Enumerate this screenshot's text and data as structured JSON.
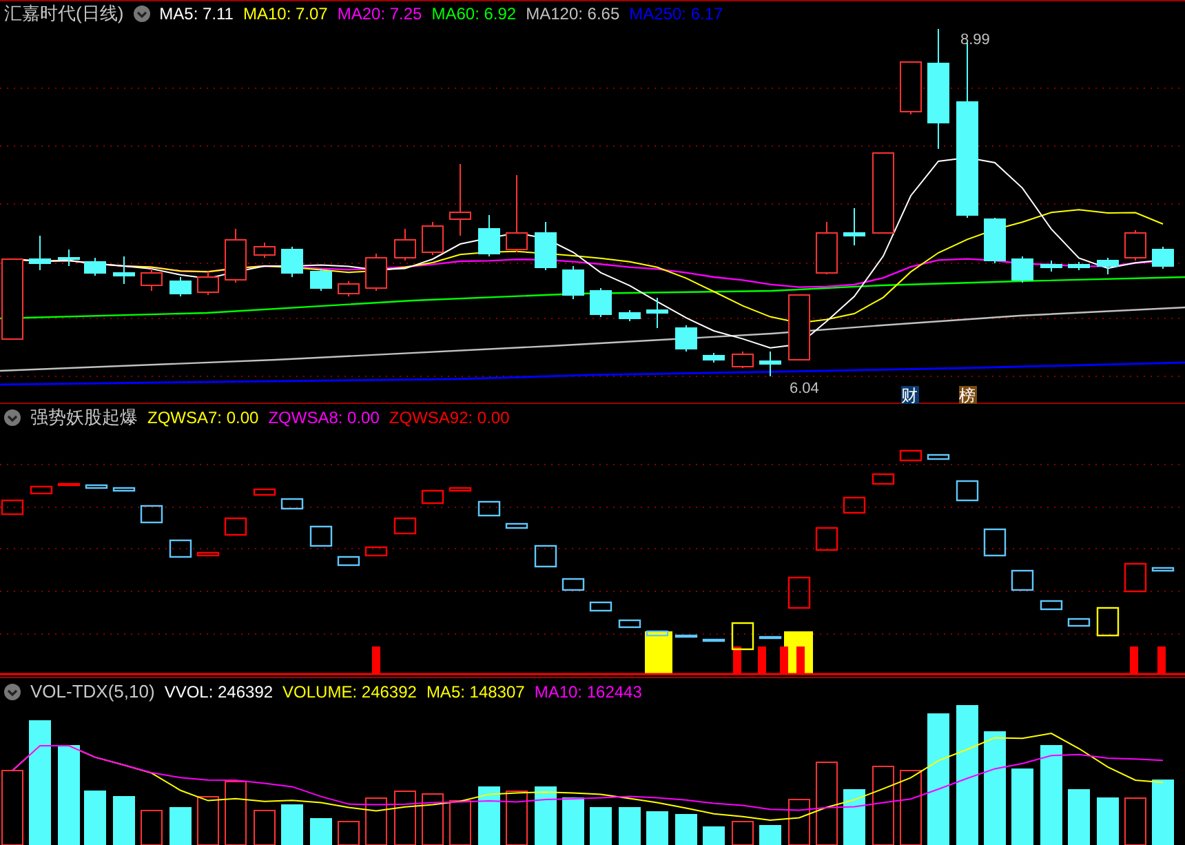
{
  "main": {
    "title": "汇嘉时代(日线)",
    "indicators": [
      {
        "label": "MA5: 7.11",
        "color": "#ffffff"
      },
      {
        "label": "MA10: 7.07",
        "color": "#ffff00"
      },
      {
        "label": "MA20: 7.25",
        "color": "#ff00ff"
      },
      {
        "label": "MA60: 6.92",
        "color": "#00ff00"
      },
      {
        "label": "MA120: 6.65",
        "color": "#c0c0c0"
      },
      {
        "label": "MA250: 6.17",
        "color": "#0000ff"
      }
    ],
    "high_label": "8.99",
    "low_label": "6.04",
    "badges": [
      {
        "text": "财",
        "color": "#0a3a6e"
      },
      {
        "text": "榜",
        "color": "#7a4a10"
      }
    ]
  },
  "signal": {
    "title": "强势妖股起爆",
    "indicators": [
      {
        "label": "ZQWSA7: 0.00",
        "color": "#ffff00"
      },
      {
        "label": "ZQWSA8: 0.00",
        "color": "#ff00ff"
      },
      {
        "label": "ZQWSA92: 0.00",
        "color": "#ff0000"
      }
    ]
  },
  "volume": {
    "title": "VOL-TDX(5,10)",
    "indicators": [
      {
        "label": "VVOL: 246392",
        "color": "#ffffff"
      },
      {
        "label": "VOLUME: 246392",
        "color": "#ffff00"
      },
      {
        "label": "MA5: 148307",
        "color": "#ffff00"
      },
      {
        "label": "MA10: 162443",
        "color": "#ff00ff"
      }
    ]
  }
}
